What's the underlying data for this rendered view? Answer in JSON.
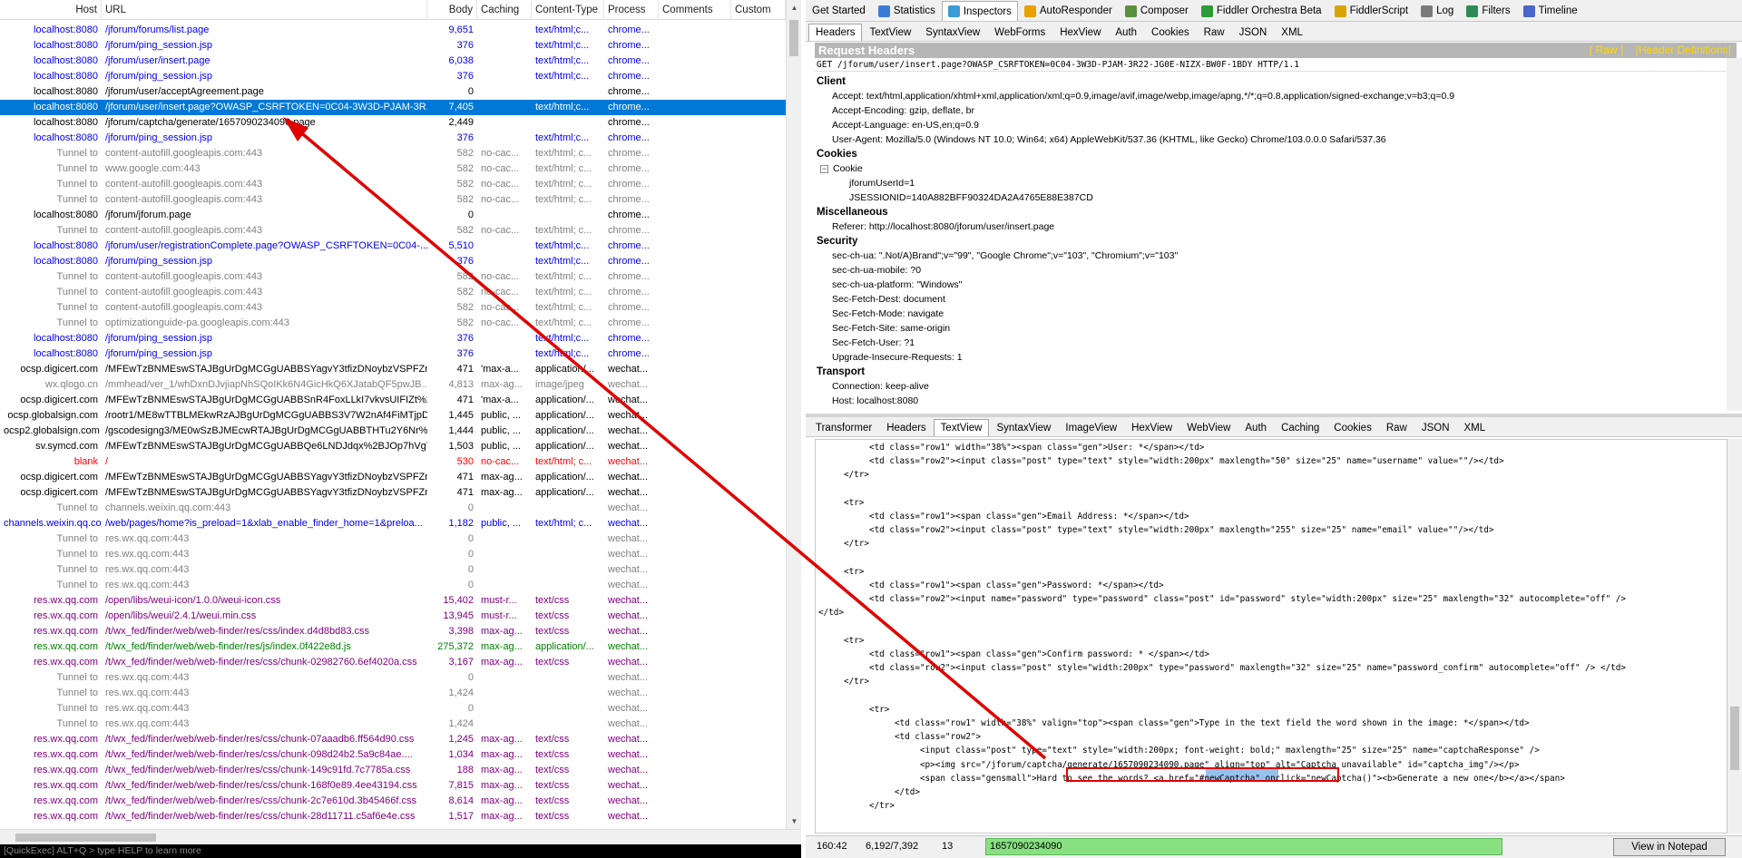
{
  "columns": [
    "Host",
    "URL",
    "Body",
    "Caching",
    "Content-Type",
    "Process",
    "Comments",
    "Custom"
  ],
  "sessions": [
    {
      "host": "localhost:8080",
      "url": "/jforum/forums/list.page",
      "body": "9,651",
      "caching": "",
      "ctype": "text/html;c...",
      "process": "chrome...",
      "style": "blue"
    },
    {
      "host": "localhost:8080",
      "url": "/jforum/ping_session.jsp",
      "body": "376",
      "caching": "",
      "ctype": "text/html;c...",
      "process": "chrome...",
      "style": "blue"
    },
    {
      "host": "localhost:8080",
      "url": "/jforum/user/insert.page",
      "body": "6,038",
      "caching": "",
      "ctype": "text/html;c...",
      "process": "chrome...",
      "style": "blue"
    },
    {
      "host": "localhost:8080",
      "url": "/jforum/ping_session.jsp",
      "body": "376",
      "caching": "",
      "ctype": "text/html;c...",
      "process": "chrome...",
      "style": "blue"
    },
    {
      "host": "localhost:8080",
      "url": "/jforum/user/acceptAgreement.page",
      "body": "0",
      "caching": "",
      "ctype": "",
      "process": "chrome...",
      "style": "black"
    },
    {
      "host": "localhost:8080",
      "url": "/jforum/user/insert.page?OWASP_CSRFTOKEN=0C04-3W3D-PJAM-3R...",
      "body": "7,405",
      "caching": "",
      "ctype": "text/html;c...",
      "process": "chrome...",
      "style": "sel"
    },
    {
      "host": "localhost:8080",
      "url": "/jforum/captcha/generate/1657090234090.page",
      "body": "2,449",
      "caching": "",
      "ctype": "",
      "process": "chrome...",
      "style": "black"
    },
    {
      "host": "localhost:8080",
      "url": "/jforum/ping_session.jsp",
      "body": "376",
      "caching": "",
      "ctype": "text/html;c...",
      "process": "chrome...",
      "style": "blue"
    },
    {
      "host": "Tunnel to",
      "url": "content-autofill.googleapis.com:443",
      "body": "582",
      "caching": "no-cac...",
      "ctype": "text/html; c...",
      "process": "chrome...",
      "style": "gray"
    },
    {
      "host": "Tunnel to",
      "url": "www.google.com:443",
      "body": "582",
      "caching": "no-cac...",
      "ctype": "text/html; c...",
      "process": "chrome...",
      "style": "gray"
    },
    {
      "host": "Tunnel to",
      "url": "content-autofill.googleapis.com:443",
      "body": "582",
      "caching": "no-cac...",
      "ctype": "text/html; c...",
      "process": "chrome...",
      "style": "gray"
    },
    {
      "host": "Tunnel to",
      "url": "content-autofill.googleapis.com:443",
      "body": "582",
      "caching": "no-cac...",
      "ctype": "text/html; c...",
      "process": "chrome...",
      "style": "gray"
    },
    {
      "host": "localhost:8080",
      "url": "/jforum/jforum.page",
      "body": "0",
      "caching": "",
      "ctype": "",
      "process": "chrome...",
      "style": "black"
    },
    {
      "host": "Tunnel to",
      "url": "content-autofill.googleapis.com:443",
      "body": "582",
      "caching": "no-cac...",
      "ctype": "text/html; c...",
      "process": "chrome...",
      "style": "gray"
    },
    {
      "host": "localhost:8080",
      "url": "/jforum/user/registrationComplete.page?OWASP_CSRFTOKEN=0C04-...",
      "body": "5,510",
      "caching": "",
      "ctype": "text/html;c...",
      "process": "chrome...",
      "style": "blue"
    },
    {
      "host": "localhost:8080",
      "url": "/jforum/ping_session.jsp",
      "body": "376",
      "caching": "",
      "ctype": "text/html;c...",
      "process": "chrome...",
      "style": "blue"
    },
    {
      "host": "Tunnel to",
      "url": "content-autofill.googleapis.com:443",
      "body": "582",
      "caching": "no-cac...",
      "ctype": "text/html; c...",
      "process": "chrome...",
      "style": "gray"
    },
    {
      "host": "Tunnel to",
      "url": "content-autofill.googleapis.com:443",
      "body": "582",
      "caching": "no-cac...",
      "ctype": "text/html; c...",
      "process": "chrome...",
      "style": "gray"
    },
    {
      "host": "Tunnel to",
      "url": "content-autofill.googleapis.com:443",
      "body": "582",
      "caching": "no-cac...",
      "ctype": "text/html; c...",
      "process": "chrome...",
      "style": "gray"
    },
    {
      "host": "Tunnel to",
      "url": "optimizationguide-pa.googleapis.com:443",
      "body": "582",
      "caching": "no-cac...",
      "ctype": "text/html; c...",
      "process": "chrome...",
      "style": "gray"
    },
    {
      "host": "localhost:8080",
      "url": "/jforum/ping_session.jsp",
      "body": "376",
      "caching": "",
      "ctype": "text/html;c...",
      "process": "chrome...",
      "style": "blue"
    },
    {
      "host": "localhost:8080",
      "url": "/jforum/ping_session.jsp",
      "body": "376",
      "caching": "",
      "ctype": "text/html;c...",
      "process": "chrome...",
      "style": "blue"
    },
    {
      "host": "ocsp.digicert.com",
      "url": "/MFEwTzBNMEswSTAJBgUrDgMCGgUABBSYagvY3tfizDNoybzVSPFZmS...",
      "body": "471",
      "caching": "'max-a...",
      "ctype": "application/...",
      "process": "wechat...",
      "style": "black"
    },
    {
      "host": "wx.qlogo.cn",
      "url": "/mmhead/ver_1/whDxnDJvjiapNhSQoIKk6N4GicHkQ6XJatabQF5pwJB...",
      "body": "4,813",
      "caching": "max-ag...",
      "ctype": "image/jpeg",
      "process": "wechat...",
      "style": "gray"
    },
    {
      "host": "ocsp.digicert.com",
      "url": "/MFEwTzBNMEswSTAJBgUrDgMCGgUABBSnR4FoxLLkI7vkvsUIFIZt%2B...",
      "body": "471",
      "caching": "'max-a...",
      "ctype": "application/...",
      "process": "wechat...",
      "style": "black"
    },
    {
      "host": "ocsp.globalsign.com",
      "url": "/rootr1/ME8wTTBLMEkwRzAJBgUrDgMCGgUABBS3V7W2nAf4FiMTjpDJ...",
      "body": "1,445",
      "caching": "public, ...",
      "ctype": "application/...",
      "process": "wechat...",
      "style": "black"
    },
    {
      "host": "ocsp2.globalsign.com",
      "url": "/gscodesigng3/ME0wSzBJMEcwRTAJBgUrDgMCGgUABBTHTu2Y6Nr%2...",
      "body": "1,444",
      "caching": "public, ...",
      "ctype": "application/...",
      "process": "wechat...",
      "style": "black"
    },
    {
      "host": "sv.symcd.com",
      "url": "/MFEwTzBNMEswSTAJBgUrDgMCGgUABBQe6LNDJdqx%2BJOp7hVgTe...",
      "body": "1,503",
      "caching": "public, ...",
      "ctype": "application/...",
      "process": "wechat...",
      "style": "black"
    },
    {
      "host": "blank",
      "url": "/",
      "body": "530",
      "caching": "no-cac...",
      "ctype": "text/html; c...",
      "process": "wechat...",
      "style": "red"
    },
    {
      "host": "ocsp.digicert.com",
      "url": "/MFEwTzBNMEswSTAJBgUrDgMCGgUABBSYagvY3tfizDNoybzVSPFZmS...",
      "body": "471",
      "caching": "max-ag...",
      "ctype": "application/...",
      "process": "wechat...",
      "style": "black"
    },
    {
      "host": "ocsp.digicert.com",
      "url": "/MFEwTzBNMEswSTAJBgUrDgMCGgUABBSYagvY3tfizDNoybzVSPFZmS...",
      "body": "471",
      "caching": "max-ag...",
      "ctype": "application/...",
      "process": "wechat...",
      "style": "black"
    },
    {
      "host": "Tunnel to",
      "url": "channels.weixin.qq.com:443",
      "body": "0",
      "caching": "",
      "ctype": "",
      "process": "wechat...",
      "style": "gray"
    },
    {
      "host": "channels.weixin.qq.com",
      "url": "/web/pages/home?is_preload=1&xlab_enable_finder_home=1&preloa...",
      "body": "1,182",
      "caching": "public, ...",
      "ctype": "text/html; c...",
      "process": "wechat...",
      "style": "blue"
    },
    {
      "host": "Tunnel to",
      "url": "res.wx.qq.com:443",
      "body": "0",
      "caching": "",
      "ctype": "",
      "process": "wechat...",
      "style": "gray"
    },
    {
      "host": "Tunnel to",
      "url": "res.wx.qq.com:443",
      "body": "0",
      "caching": "",
      "ctype": "",
      "process": "wechat...",
      "style": "gray"
    },
    {
      "host": "Tunnel to",
      "url": "res.wx.qq.com:443",
      "body": "0",
      "caching": "",
      "ctype": "",
      "process": "wechat...",
      "style": "gray"
    },
    {
      "host": "Tunnel to",
      "url": "res.wx.qq.com:443",
      "body": "0",
      "caching": "",
      "ctype": "",
      "process": "wechat...",
      "style": "gray"
    },
    {
      "host": "res.wx.qq.com",
      "url": "/open/libs/weui-icon/1.0.0/weui-icon.css",
      "body": "15,402",
      "caching": "must-r...",
      "ctype": "text/css",
      "process": "wechat...",
      "style": "purple"
    },
    {
      "host": "res.wx.qq.com",
      "url": "/open/libs/weui/2.4.1/weui.min.css",
      "body": "13,945",
      "caching": "must-r...",
      "ctype": "text/css",
      "process": "wechat...",
      "style": "purple"
    },
    {
      "host": "res.wx.qq.com",
      "url": "/t/wx_fed/finder/web/web-finder/res/css/index.d4d8bd83.css",
      "body": "3,398",
      "caching": "max-ag...",
      "ctype": "text/css",
      "process": "wechat...",
      "style": "purple"
    },
    {
      "host": "res.wx.qq.com",
      "url": "/t/wx_fed/finder/web/web-finder/res/js/index.0f422e8d.js",
      "body": "275,372",
      "caching": "max-ag...",
      "ctype": "application/...",
      "process": "wechat...",
      "style": "green"
    },
    {
      "host": "res.wx.qq.com",
      "url": "/t/wx_fed/finder/web/web-finder/res/css/chunk-02982760.6ef4020a.css",
      "body": "3,167",
      "caching": "max-ag...",
      "ctype": "text/css",
      "process": "wechat...",
      "style": "purple"
    },
    {
      "host": "Tunnel to",
      "url": "res.wx.qq.com:443",
      "body": "0",
      "caching": "",
      "ctype": "",
      "process": "wechat...",
      "style": "gray"
    },
    {
      "host": "Tunnel to",
      "url": "res.wx.qq.com:443",
      "body": "1,424",
      "caching": "",
      "ctype": "",
      "process": "wechat...",
      "style": "gray"
    },
    {
      "host": "Tunnel to",
      "url": "res.wx.qq.com:443",
      "body": "0",
      "caching": "",
      "ctype": "",
      "process": "wechat...",
      "style": "gray"
    },
    {
      "host": "Tunnel to",
      "url": "res.wx.qq.com:443",
      "body": "1,424",
      "caching": "",
      "ctype": "",
      "process": "wechat...",
      "style": "gray"
    },
    {
      "host": "res.wx.qq.com",
      "url": "/t/wx_fed/finder/web/web-finder/res/css/chunk-07aaadb6.ff564d90.css",
      "body": "1,245",
      "caching": "max-ag...",
      "ctype": "text/css",
      "process": "wechat...",
      "style": "purple"
    },
    {
      "host": "res.wx.qq.com",
      "url": "/t/wx_fed/finder/web/web-finder/res/css/chunk-098d24b2.5a9c84ae....",
      "body": "1,034",
      "caching": "max-ag...",
      "ctype": "text/css",
      "process": "wechat...",
      "style": "purple"
    },
    {
      "host": "res.wx.qq.com",
      "url": "/t/wx_fed/finder/web/web-finder/res/css/chunk-149c91fd.7c7785a.css",
      "body": "188",
      "caching": "max-ag...",
      "ctype": "text/css",
      "process": "wechat...",
      "style": "purple"
    },
    {
      "host": "res.wx.qq.com",
      "url": "/t/wx_fed/finder/web/web-finder/res/css/chunk-168f0e89.4ee43194.css",
      "body": "7,815",
      "caching": "max-ag...",
      "ctype": "text/css",
      "process": "wechat...",
      "style": "purple"
    },
    {
      "host": "res.wx.qq.com",
      "url": "/t/wx_fed/finder/web/web-finder/res/css/chunk-2c7e610d.3b45466f.css",
      "body": "8,614",
      "caching": "max-ag...",
      "ctype": "text/css",
      "process": "wechat...",
      "style": "purple"
    },
    {
      "host": "res.wx.qq.com",
      "url": "/t/wx_fed/finder/web/web-finder/res/css/chunk-28d11711.c5af6e4e.css",
      "body": "1,517",
      "caching": "max-ag...",
      "ctype": "text/css",
      "process": "wechat...",
      "style": "purple"
    }
  ],
  "quickexec": "[QuickExec] ALT+Q > type HELP to learn more",
  "top_tabs": [
    {
      "label": "Get Started",
      "icon": "",
      "active": false
    },
    {
      "label": "Statistics",
      "icon": "statistics-icon",
      "active": false
    },
    {
      "label": "Inspectors",
      "icon": "inspectors-icon",
      "active": true
    },
    {
      "label": "AutoResponder",
      "icon": "autoresponder-icon",
      "active": false
    },
    {
      "label": "Composer",
      "icon": "composer-icon",
      "active": false
    },
    {
      "label": "Fiddler Orchestra Beta",
      "icon": "orchestra-icon",
      "active": false
    },
    {
      "label": "FiddlerScript",
      "icon": "fiddlerscript-icon",
      "active": false
    },
    {
      "label": "Log",
      "icon": "log-icon",
      "active": false
    },
    {
      "label": "Filters",
      "icon": "filters-icon",
      "active": false
    },
    {
      "label": "Timeline",
      "icon": "timeline-icon",
      "active": false
    }
  ],
  "request_tabs": [
    "Headers",
    "TextView",
    "SyntaxView",
    "WebForms",
    "HexView",
    "Auth",
    "Cookies",
    "Raw",
    "JSON",
    "XML"
  ],
  "request_active": "Headers",
  "request_headers": {
    "title": "Request Headers",
    "raw_link": "[ Raw ]",
    "defs_link": "[Header Definitions]",
    "request_line": "GET /jforum/user/insert.page?OWASP_CSRFTOKEN=0C04-3W3D-PJAM-3R22-JG0E-NIZX-BW0F-1BDY HTTP/1.1",
    "client_label": "Client",
    "client": [
      "Accept: text/html,application/xhtml+xml,application/xml;q=0.9,image/avif,image/webp,image/apng,*/*;q=0.8,application/signed-exchange;v=b3;q=0.9",
      "Accept-Encoding: gzip, deflate, br",
      "Accept-Language: en-US,en;q=0.9",
      "User-Agent: Mozilla/5.0 (Windows NT 10.0; Win64; x64) AppleWebKit/537.36 (KHTML, like Gecko) Chrome/103.0.0.0 Safari/537.36"
    ],
    "cookies_label": "Cookies",
    "cookie_node": "Cookie",
    "cookies": [
      "jforumUserId=1",
      "JSESSIONID=140A882BFF90324DA2A4765E88E387CD"
    ],
    "misc_label": "Miscellaneous",
    "misc": [
      "Referer: http://localhost:8080/jforum/user/insert.page"
    ],
    "security_label": "Security",
    "security": [
      "sec-ch-ua: \".Not/A)Brand\";v=\"99\", \"Google Chrome\";v=\"103\", \"Chromium\";v=\"103\"",
      "sec-ch-ua-mobile: ?0",
      "sec-ch-ua-platform: \"Windows\"",
      "Sec-Fetch-Dest: document",
      "Sec-Fetch-Mode: navigate",
      "Sec-Fetch-Site: same-origin",
      "Sec-Fetch-User: ?1",
      "Upgrade-Insecure-Requests: 1"
    ],
    "transport_label": "Transport",
    "transport": [
      "Connection: keep-alive",
      "Host: localhost:8080"
    ]
  },
  "response_tabs": [
    "Transformer",
    "Headers",
    "TextView",
    "SyntaxView",
    "ImageView",
    "HexView",
    "WebView",
    "Auth",
    "Caching",
    "Cookies",
    "Raw",
    "JSON",
    "XML"
  ],
  "response_active": "TextView",
  "textview_lines": [
    "          <td class=\"row1\" width=\"38%\"><span class=\"gen\">User: *</span></td>",
    "          <td class=\"row2\"><input class=\"post\" type=\"text\" style=\"width:200px\" maxlength=\"50\" size=\"25\" name=\"username\" value=\"\"/></td>",
    "     </tr>",
    "",
    "     <tr>",
    "          <td class=\"row1\"><span class=\"gen\">Email Address: *</span></td>",
    "          <td class=\"row2\"><input class=\"post\" type=\"text\" style=\"width:200px\" maxlength=\"255\" size=\"25\" name=\"email\" value=\"\"/></td>",
    "     </tr>",
    "",
    "     <tr>",
    "          <td class=\"row1\"><span class=\"gen\">Password: *</span></td>",
    "          <td class=\"row2\"><input name=\"password\" type=\"password\" class=\"post\" id=\"password\" style=\"width:200px\" size=\"25\" maxlength=\"32\" autocomplete=\"off\" />",
    "</td>",
    "",
    "     <tr>",
    "          <td class=\"row1\"><span class=\"gen\">Confirm password: * </span></td>",
    "          <td class=\"row2\"><input class=\"post\" style=\"width:200px\" type=\"password\" maxlength=\"32\" size=\"25\" name=\"password_confirm\" autocomplete=\"off\" /> </td>",
    "     </tr>",
    "",
    "          <tr>",
    "               <td class=\"row1\" width=\"38%\" valign=\"top\"><span class=\"gen\">Type in the text field the word shown in the image: *</span></td>",
    "               <td class=\"row2\">",
    "                    <input class=\"post\" type=\"text\" style=\"width:200px; font-weight: bold;\" maxlength=\"25\" size=\"25\" name=\"captchaResponse\" />",
    "                    <p><img src=\"/jforum/captcha/generate/1657090234090.page\" align=\"top\" alt=\"Captcha unavailable\" id=\"captcha_img\"/></p>",
    "                    <span class=\"gensmall\">Hard to see the words? <a href=\"#newCaptcha\" onclick=\"newCaptcha()\"><b>Generate a new one</b></a></span>",
    "               </td>",
    "          </tr>"
  ],
  "status": {
    "position": "160:42",
    "bytes": "6,192/7,392",
    "count": "13",
    "find_value": "1657090234090",
    "notepad_button": "View in Notepad"
  },
  "colors": {
    "selected_row": "#0078d7",
    "highlight_box": "#e00000",
    "arrow": "#e00000",
    "find_box": "#88e080"
  }
}
